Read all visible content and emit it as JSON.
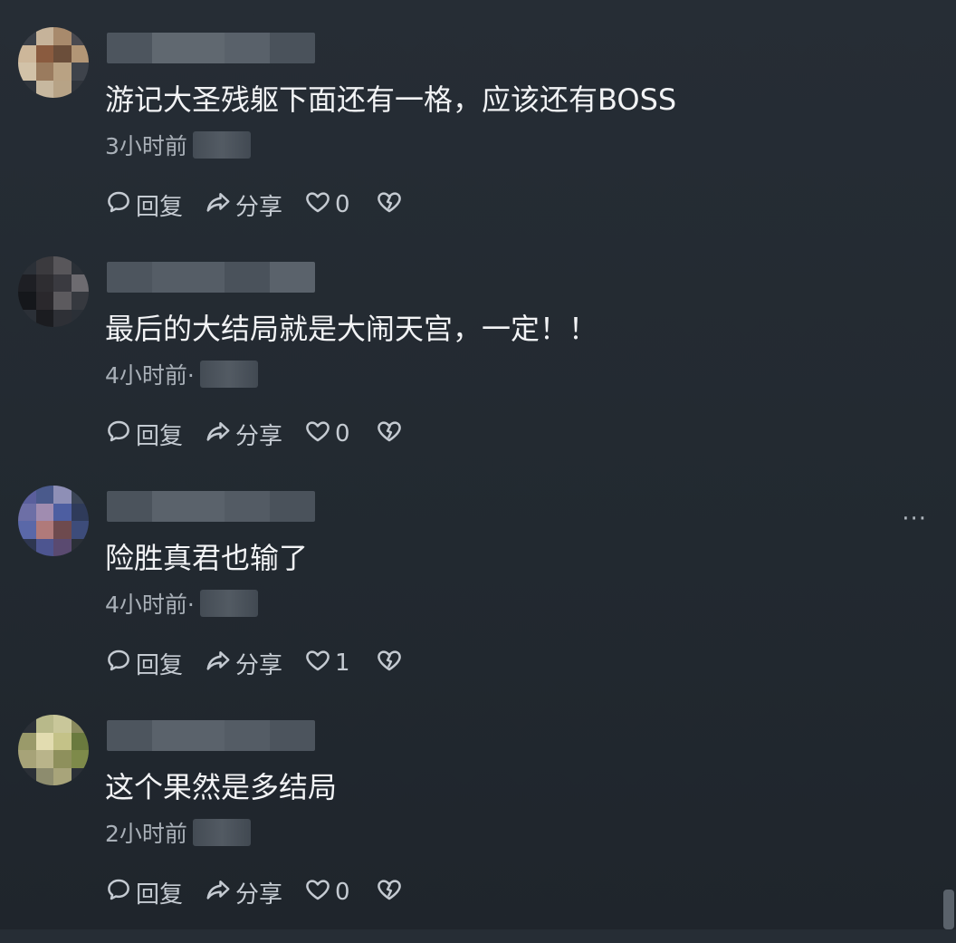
{
  "comments": [
    {
      "text": "游记大圣残躯下面还有一格，应该还有BOSS",
      "time": "3小时前",
      "reply_label": "回复",
      "share_label": "分享",
      "likes": "0",
      "avatar_colors": [
        "#3b4048",
        "#c6b39a",
        "#a88a6c",
        "#4a4a50",
        "#cdb79a",
        "#8a5b3f",
        "#6b4e3a",
        "#b29676",
        "#d2c2a8",
        "#9a7b5e",
        "#b9a283",
        "#3e434b",
        "#30353c",
        "#c7b89f",
        "#b7a386",
        "#30353c"
      ],
      "username_colors": [
        "#4d555e",
        "#606870",
        "#59616a",
        "#4a525b"
      ]
    },
    {
      "text": "最后的大结局就是大闹天宫，一定！！",
      "time": "4小时前·",
      "reply_label": "回复",
      "share_label": "分享",
      "likes": "0",
      "avatar_colors": [
        "#2b3037",
        "#3b3a3e",
        "#58565a",
        "#2b3037",
        "#1e1f24",
        "#2e2d31",
        "#3a3a40",
        "#6d6b70",
        "#15171b",
        "#2a282c",
        "#5c5a5e",
        "#36393f",
        "#2b3037",
        "#1b1c20",
        "#2e3036",
        "#2b3037"
      ],
      "username_colors": [
        "#4d555e",
        "#555d66",
        "#4a525b",
        "#5a626b"
      ]
    },
    {
      "text": "险胜真君也输了",
      "time": "4小时前·",
      "reply_label": "回复",
      "share_label": "分享",
      "likes": "1",
      "avatar_colors": [
        "#5a5f9c",
        "#4a5a8c",
        "#8e8fb6",
        "#3b4556",
        "#6d6fa6",
        "#a08cb0",
        "#4d5ea1",
        "#2f3b5a",
        "#5a68a8",
        "#b07a7a",
        "#6e4a4e",
        "#3d4c7a",
        "#2e3650",
        "#4d5590",
        "#5a4a70",
        "#2b3037"
      ],
      "username_colors": [
        "#4b535c",
        "#5a626b",
        "#535b64",
        "#4a525b"
      ]
    },
    {
      "text": "这个果然是多结局",
      "time": "2小时前",
      "reply_label": "回复",
      "share_label": "分享",
      "likes": "0",
      "avatar_colors": [
        "#2b3037",
        "#b8b98a",
        "#c9c79a",
        "#8a8a5e",
        "#9a9a6a",
        "#e2dcb0",
        "#c4c288",
        "#6a7a3e",
        "#a7a378",
        "#b9b48a",
        "#8e905c",
        "#7e8a4a",
        "#2b3037",
        "#8d8c6e",
        "#a8a47a",
        "#2b3037"
      ],
      "username_colors": [
        "#4d555e",
        "#5a626b",
        "#545c65",
        "#4c545d"
      ]
    }
  ],
  "more_label": "···"
}
